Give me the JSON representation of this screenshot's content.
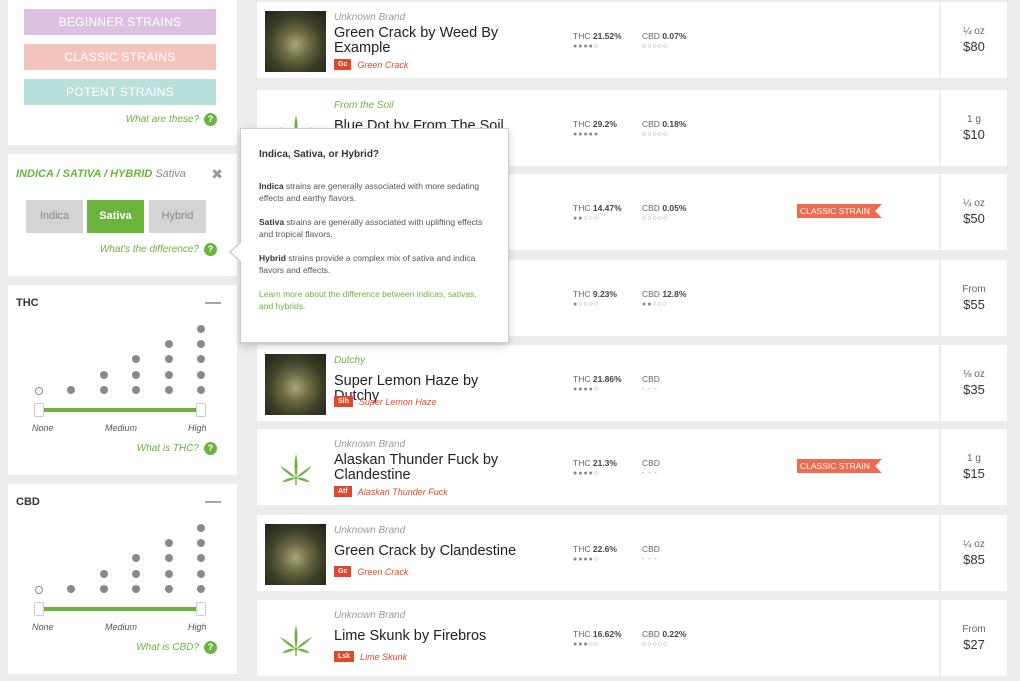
{
  "strain_buttons": [
    {
      "label": "BEGINNER STRAINS",
      "color": "#dcc2e0"
    },
    {
      "label": "CLASSIC STRAINS",
      "color": "#f2c4bd"
    },
    {
      "label": "POTENT STRAINS",
      "color": "#b6e0d9"
    }
  ],
  "strain_help": "What are these?",
  "type_filter": {
    "title": "INDICA / SATIVA / HYBRID",
    "selected": "Sativa",
    "options": [
      "Indica",
      "Sativa",
      "Hybrid"
    ],
    "help": "What's the difference?"
  },
  "thc_filter": {
    "title": "THC",
    "low": "None",
    "mid": "Medium",
    "high": "High",
    "help": "What is THC?"
  },
  "cbd_filter": {
    "title": "CBD",
    "low": "None",
    "mid": "Medium",
    "high": "High",
    "help": "What is CBD?"
  },
  "popover": {
    "title": "Indica, Sativa, or Hybrid?",
    "indica_term": "Indica",
    "indica_text": " strains are generally associated with more sedating effects and earthy flavors.",
    "sativa_term": "Sativa",
    "sativa_text": " strains are generally associated with uplifting effects and tropical flavors.",
    "hybrid_term": "Hybrid",
    "hybrid_text": " strains provide a complex mix of sativa and indica flavors and effects.",
    "link": "Learn more about the difference between indicas, sativas, and hybrids."
  },
  "products": [
    {
      "brand": "Unknown Brand",
      "name": "Green Crack by Weed By Example",
      "abbr": "Gc",
      "strain": "Green Crack",
      "thc_label": "THC",
      "thc": "21.52%",
      "thc_level": 4,
      "cbd_label": "CBD",
      "cbd": "0.07%",
      "cbd_level": 0,
      "classic": "",
      "qty": "¼ oz",
      "price": "$80",
      "image": "photo"
    },
    {
      "brand": "From the Soil",
      "name": "Blue Dot by From The Soil",
      "abbr": "",
      "strain": "",
      "thc_label": "THC",
      "thc": "29.2%",
      "thc_level": 5,
      "cbd_label": "CBD",
      "cbd": "0.18%",
      "cbd_level": 0,
      "classic": "",
      "qty": "1 g",
      "price": "$10",
      "image": "leaf"
    },
    {
      "brand": "",
      "name": "",
      "abbr": "",
      "strain": "",
      "thc_label": "THC",
      "thc": "14.47%",
      "thc_level": 2,
      "cbd_label": "CBD",
      "cbd": "0.05%",
      "cbd_level": 0,
      "classic": "CLASSIC STRAIN",
      "qty": "¼ oz",
      "price": "$50",
      "image": "none"
    },
    {
      "brand": "",
      "name": "",
      "abbr": "",
      "strain": "",
      "thc_label": "THC",
      "thc": "9.23%",
      "thc_level": 1,
      "cbd_label": "CBD",
      "cbd": "12.8%",
      "cbd_level": 2,
      "classic": "",
      "qty": "From",
      "price": "$55",
      "image": "none"
    },
    {
      "brand": "Dutchy",
      "name": "Super Lemon Haze by Dutchy",
      "abbr": "Slh",
      "strain": "Super Lemon Haze",
      "thc_label": "THC",
      "thc": "21.86%",
      "thc_level": 4,
      "cbd_label": "CBD",
      "cbd": "- - -",
      "cbd_level": -1,
      "classic": "",
      "qty": "⅛ oz",
      "price": "$35",
      "image": "photo"
    },
    {
      "brand": "Unknown Brand",
      "name": "Alaskan Thunder Fuck by Clandestine",
      "abbr": "Atf",
      "strain": "Alaskan Thunder Fuck",
      "thc_label": "THC",
      "thc": "21.3%",
      "thc_level": 4,
      "cbd_label": "CBD",
      "cbd": "- - -",
      "cbd_level": -1,
      "classic": "CLASSIC STRAIN",
      "qty": "1 g",
      "price": "$15",
      "image": "leaf"
    },
    {
      "brand": "Unknown Brand",
      "name": "Green Crack by Clandestine",
      "abbr": "Gc",
      "strain": "Green Crack",
      "thc_label": "THC",
      "thc": "22.6%",
      "thc_level": 4,
      "cbd_label": "CBD",
      "cbd": "- - -",
      "cbd_level": -1,
      "classic": "",
      "qty": "¼ oz",
      "price": "$85",
      "image": "photo"
    },
    {
      "brand": "Unknown Brand",
      "name": "Lime Skunk by Firebros",
      "abbr": "Lsk",
      "strain": "Lime Skunk",
      "thc_label": "THC",
      "thc": "16.62%",
      "thc_level": 3,
      "cbd_label": "CBD",
      "cbd": "0.22%",
      "cbd_level": 0,
      "classic": "",
      "qty": "From",
      "price": "$27",
      "image": "leaf"
    }
  ]
}
